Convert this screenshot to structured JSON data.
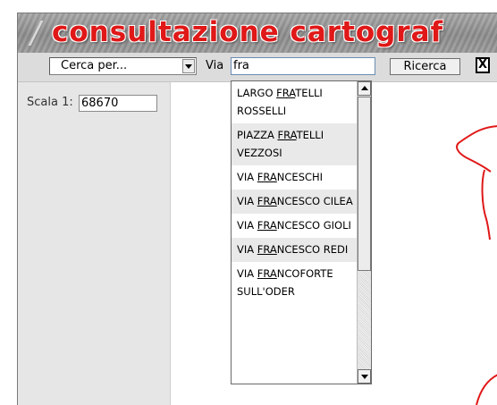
{
  "banner": {
    "title": "consultazione cartograf",
    "title_color": "#e01818"
  },
  "toolbar": {
    "search_by_value": "Cerca per...",
    "via_label": "Via",
    "via_value": "fra",
    "search_button_label": "Ricerca",
    "close_label": "X"
  },
  "scale": {
    "label": "Scala 1:",
    "value": "68670"
  },
  "suggestions": {
    "match": "FRA",
    "items": [
      {
        "before": "LARGO ",
        "match": "FRA",
        "after": "TELLI ROSSELLI"
      },
      {
        "before": "PIAZZA ",
        "match": "FRA",
        "after": "TELLI VEZZOSI"
      },
      {
        "before": "VIA ",
        "match": "FRA",
        "after": "NCESCHI"
      },
      {
        "before": "VIA ",
        "match": "FRA",
        "after": "NCESCO CILEA"
      },
      {
        "before": "VIA ",
        "match": "FRA",
        "after": "NCESCO GIOLI"
      },
      {
        "before": "VIA ",
        "match": "FRA",
        "after": "NCESCO REDI"
      },
      {
        "before": "VIA ",
        "match": "FRA",
        "after": "NCOFORTE SULL'ODER"
      }
    ]
  },
  "map": {
    "line_color": "#e01818"
  }
}
